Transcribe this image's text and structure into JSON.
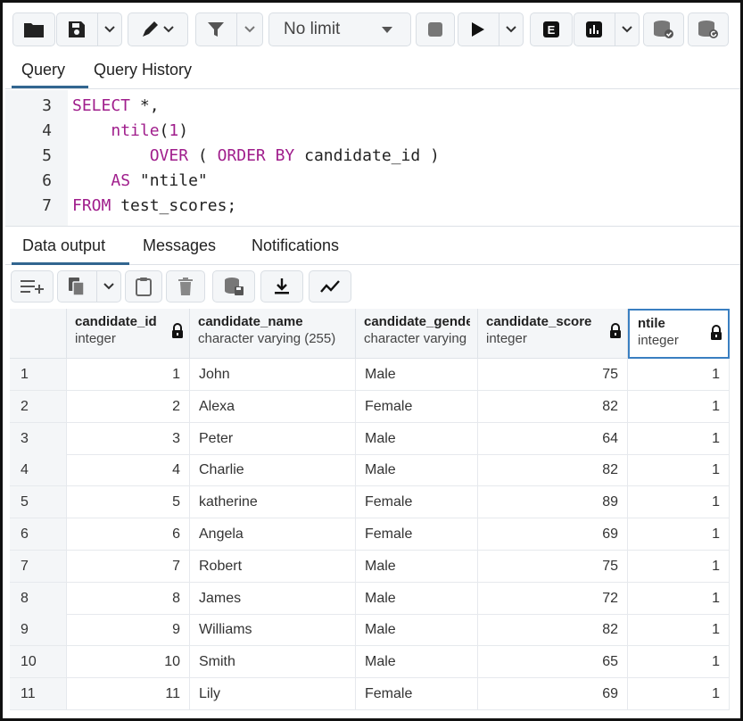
{
  "toolbar": {
    "limit_value": "No limit",
    "buttons": [
      "open-file-icon",
      "save-icon",
      "edit-icon",
      "filter-icon",
      "stop-icon",
      "execute-icon",
      "explain-icon",
      "explain-analyze-icon",
      "commit-icon",
      "rollback-icon"
    ]
  },
  "query_tabs": {
    "query": "Query",
    "history": "Query History"
  },
  "editor": {
    "lines": [
      {
        "num": "3",
        "text": "SELECT *,"
      },
      {
        "num": "4",
        "text": "ntile(1)"
      },
      {
        "num": "5",
        "text": "OVER ( ORDER BY candidate_id )"
      },
      {
        "num": "6",
        "text": "AS \"ntile\""
      },
      {
        "num": "7",
        "text": "FROM test_scores;"
      }
    ]
  },
  "result_tabs": {
    "data_output": "Data output",
    "messages": "Messages",
    "notifications": "Notifications"
  },
  "grid": {
    "columns": [
      {
        "name": "candidate_id",
        "type": "integer"
      },
      {
        "name": "candidate_name",
        "type": "character varying (255)"
      },
      {
        "name": "candidate_gender",
        "type": "character varying"
      },
      {
        "name": "candidate_score",
        "type": "integer"
      },
      {
        "name": "ntile",
        "type": "integer"
      }
    ],
    "rows": [
      [
        "1",
        "1",
        "John",
        "Male",
        "75",
        "1"
      ],
      [
        "2",
        "2",
        "Alexa",
        "Female",
        "82",
        "1"
      ],
      [
        "3",
        "3",
        "Peter",
        "Male",
        "64",
        "1"
      ],
      [
        "4",
        "4",
        "Charlie",
        "Male",
        "82",
        "1"
      ],
      [
        "5",
        "5",
        "katherine",
        "Female",
        "89",
        "1"
      ],
      [
        "6",
        "6",
        "Angela",
        "Female",
        "69",
        "1"
      ],
      [
        "7",
        "7",
        "Robert",
        "Male",
        "75",
        "1"
      ],
      [
        "8",
        "8",
        "James",
        "Male",
        "72",
        "1"
      ],
      [
        "9",
        "9",
        "Williams",
        "Male",
        "82",
        "1"
      ],
      [
        "10",
        "10",
        "Smith",
        "Male",
        "65",
        "1"
      ],
      [
        "11",
        "11",
        "Lily",
        "Female",
        "69",
        "1"
      ]
    ]
  }
}
